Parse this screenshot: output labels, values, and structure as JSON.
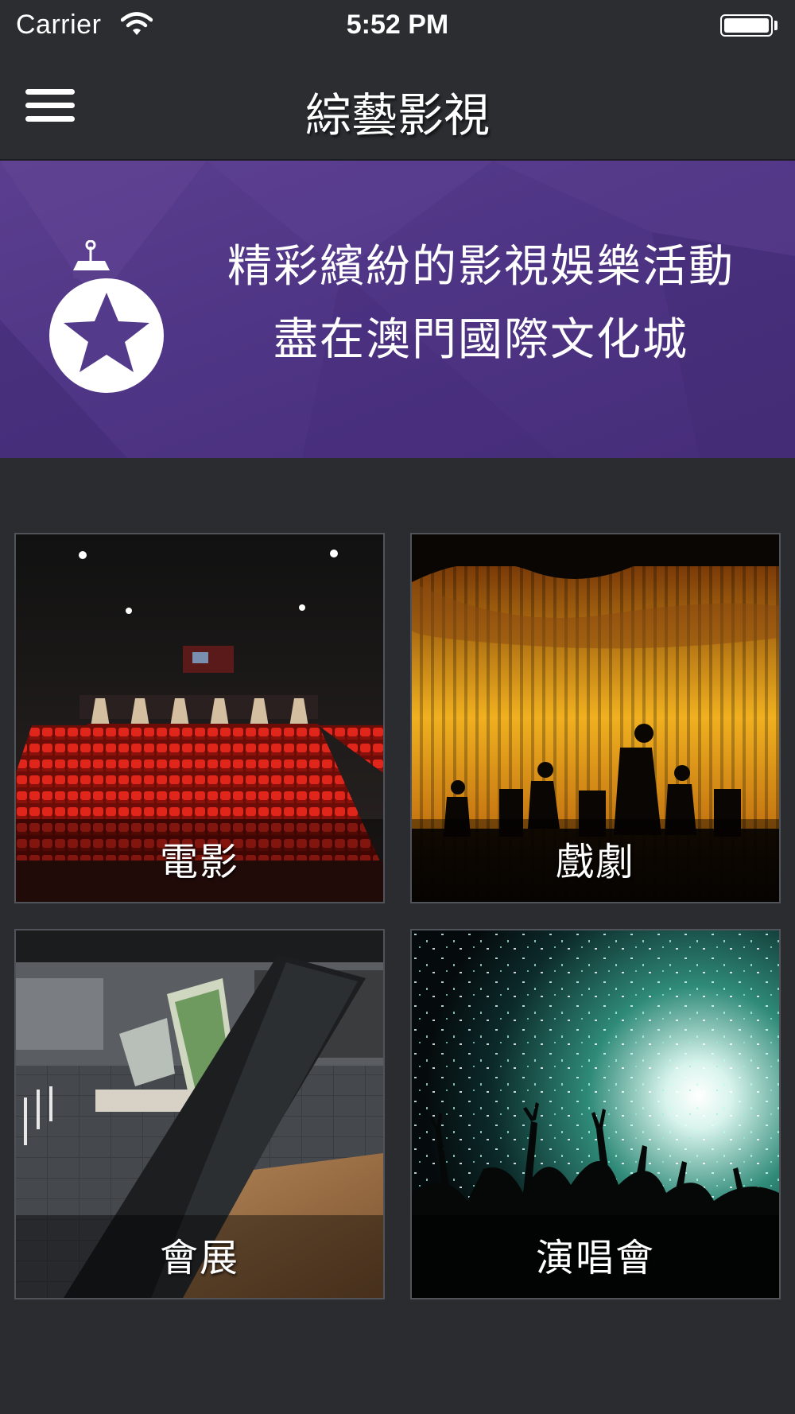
{
  "status_bar": {
    "carrier": "Carrier",
    "time": "5:52 PM"
  },
  "nav": {
    "title": "綜藝影視",
    "menu_icon": "hamburger-menu-icon"
  },
  "banner": {
    "icon": "star-ornament-icon",
    "line1": "精彩繽紛的影視娛樂活動",
    "line2": "盡在澳門國際文化城",
    "color": "#533a8a"
  },
  "tiles": [
    {
      "label": "電影",
      "image": "cinema-seats-photo"
    },
    {
      "label": "戲劇",
      "image": "theatre-stage-curtain-photo"
    },
    {
      "label": "會展",
      "image": "exhibition-hall-photo"
    },
    {
      "label": "演唱會",
      "image": "concert-crowd-photo"
    }
  ]
}
